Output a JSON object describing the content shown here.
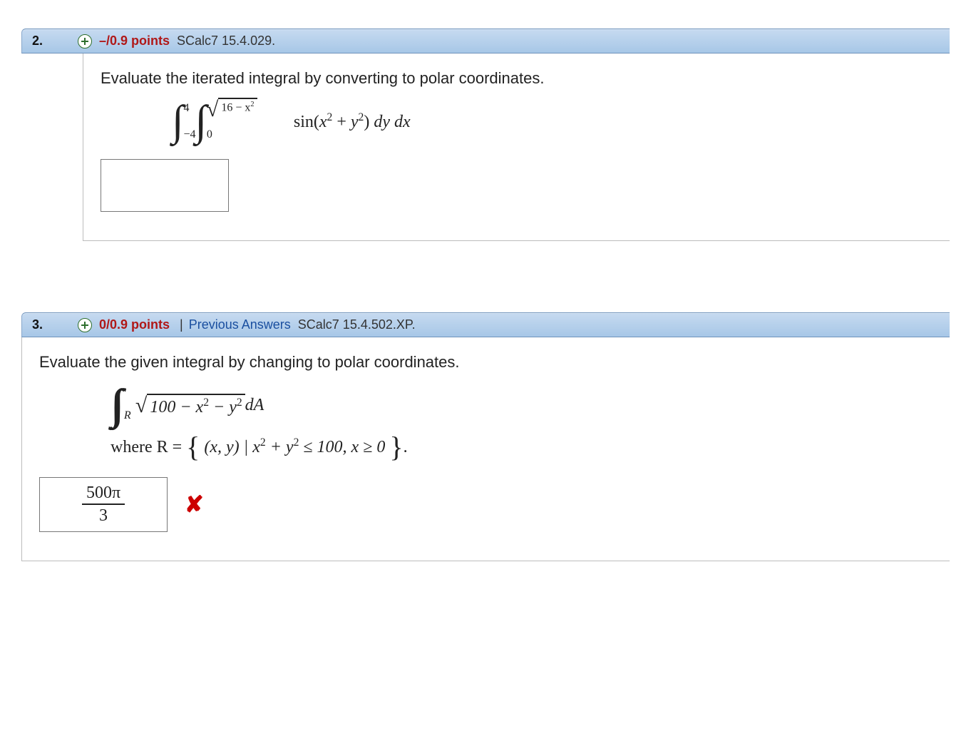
{
  "q2": {
    "number": "2.",
    "points": "–/0.9 points",
    "ref": "SCalc7 15.4.029.",
    "prompt": "Evaluate the iterated integral by converting to polar coordinates.",
    "outer_upper": "4",
    "outer_lower": "−4",
    "inner_upper_inside": "16 − x",
    "inner_upper_exp": "2",
    "inner_lower": "0",
    "integrand_prefix": "sin(",
    "integrand_x": "x",
    "integrand_exp1": "2",
    "integrand_plus": " + ",
    "integrand_y": "y",
    "integrand_exp2": "2",
    "integrand_suffix": ")",
    "diff": " dy dx",
    "answer": ""
  },
  "q3": {
    "number": "3.",
    "points": "0/0.9 points",
    "prev": "Previous Answers",
    "ref": "SCalc7 15.4.502.XP.",
    "prompt": "Evaluate the given integral by changing to polar coordinates.",
    "region_sub": "R",
    "sqrt_inside_a": "100 − x",
    "sqrt_exp1": "2",
    "sqrt_inside_b": " − y",
    "sqrt_exp2": "2",
    "dA": " dA",
    "where_label": "where R = ",
    "set_body_a": "(x, y) | x",
    "set_exp1": "2",
    "set_body_b": " + y",
    "set_exp2": "2",
    "set_body_c": " ≤ 100, x ≥ 0",
    "answer_num": "500π",
    "answer_den": "3"
  }
}
